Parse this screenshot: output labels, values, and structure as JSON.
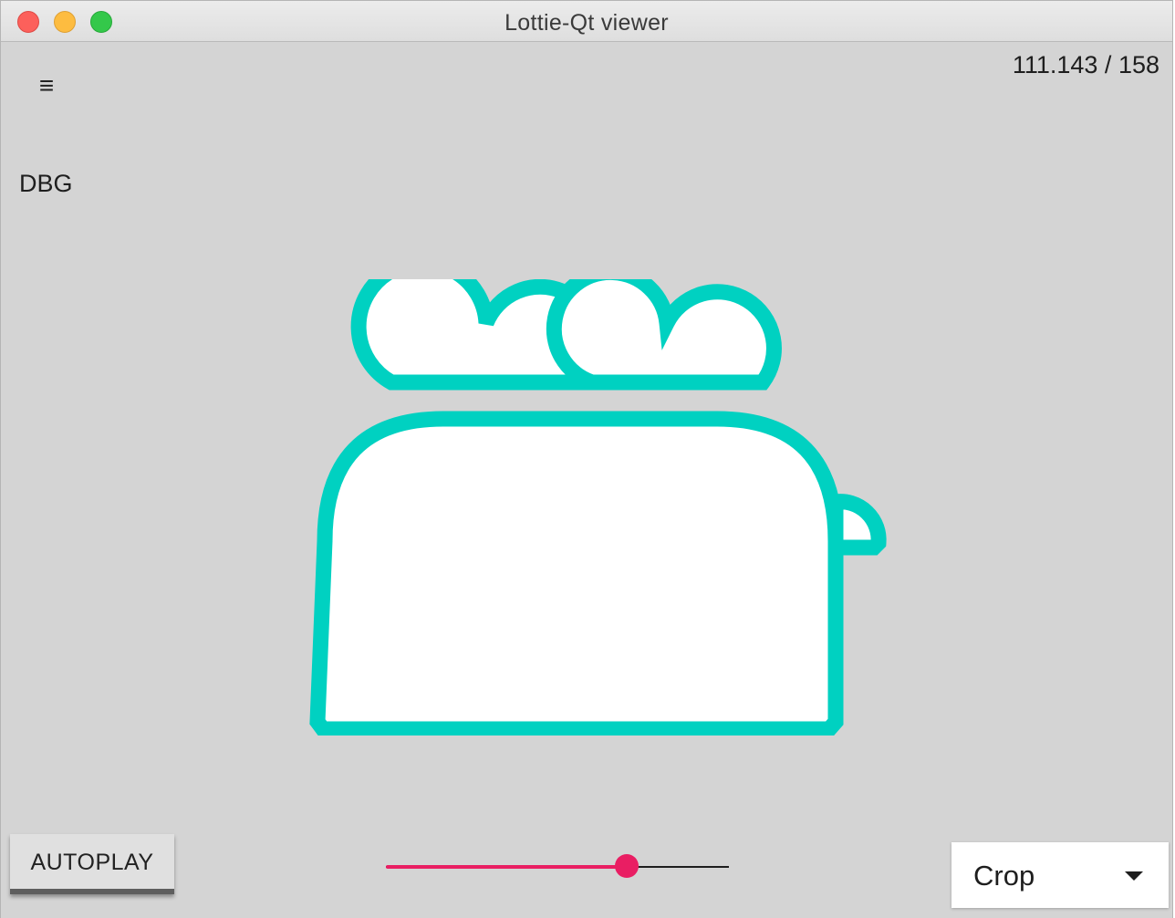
{
  "window": {
    "title": "Lottie-Qt viewer"
  },
  "toolbar": {
    "menu_icon": "≡",
    "frame_counter": "111.143 / 158",
    "debug_label": "DBG"
  },
  "animation": {
    "name": "toaster",
    "stroke_color": "#00d1c1",
    "fill_color": "#ffffff"
  },
  "controls": {
    "autoplay_label": "AUTOPLAY",
    "progress": {
      "current_frame": 111.143,
      "total_frames": 158,
      "fill_color": "#e91e63"
    },
    "fill_mode": {
      "selected": "Crop"
    }
  }
}
